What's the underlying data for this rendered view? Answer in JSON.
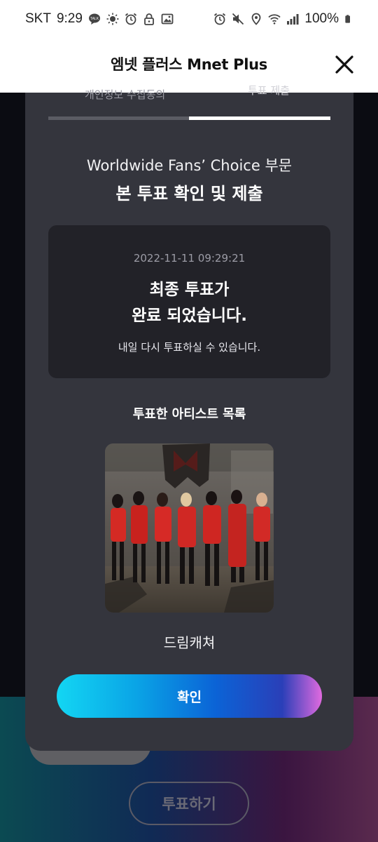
{
  "status_bar": {
    "carrier": "SKT",
    "time": "9:29",
    "battery": "100%",
    "left_icons": [
      "talk-icon",
      "brightness-icon",
      "alarm-icon",
      "lock-icon",
      "gallery-icon"
    ],
    "right_icons": [
      "alarm-icon",
      "mute-icon",
      "location-icon",
      "wifi-icon",
      "signal-icon",
      "battery-icon"
    ]
  },
  "header": {
    "title": "엠넷 플러스 Mnet Plus",
    "close_icon": "close-icon"
  },
  "modal": {
    "tabs": [
      {
        "label": "개인정보 수집동의",
        "active": false
      },
      {
        "label": "투표 제출",
        "active": true
      }
    ],
    "category": "Worldwide Fans’ Choice 부문",
    "title": "본 투표 확인 및 제출",
    "result": {
      "timestamp": "2022-11-11 09:29:21",
      "line1": "최종 투표가",
      "line2": "완료 되었습니다.",
      "note": "내일 다시 투표하실 수 있습니다."
    },
    "voted_list_title": "투표한 아티스트 목록",
    "artist": {
      "name": "드림캐쳐"
    },
    "confirm_label": "확인"
  },
  "background": {
    "vote_button_label": "투표하기"
  },
  "colors": {
    "modal_bg": "#34353d",
    "result_box_bg": "#222228",
    "button_gradient_start": "#13d6f3",
    "button_gradient_end": "#e06adf"
  }
}
